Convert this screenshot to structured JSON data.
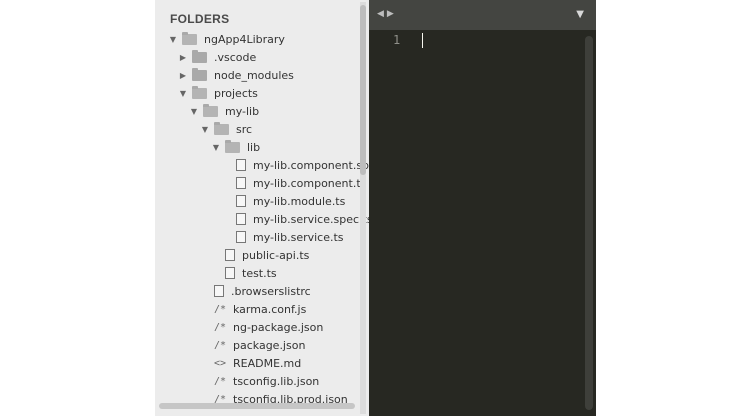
{
  "sidebar": {
    "title": "FOLDERS",
    "items": [
      {
        "label": "ngApp4Library",
        "type": "folder",
        "state": "open"
      },
      {
        "label": ".vscode",
        "type": "folder",
        "state": "closed"
      },
      {
        "label": "node_modules",
        "type": "folder",
        "state": "closed"
      },
      {
        "label": "projects",
        "type": "folder",
        "state": "open"
      },
      {
        "label": "my-lib",
        "type": "folder",
        "state": "open"
      },
      {
        "label": "src",
        "type": "folder",
        "state": "open"
      },
      {
        "label": "lib",
        "type": "folder",
        "state": "open"
      },
      {
        "label": "my-lib.component.sp",
        "type": "file",
        "icon": "file-icon"
      },
      {
        "label": "my-lib.component.ts",
        "type": "file",
        "icon": "file-icon"
      },
      {
        "label": "my-lib.module.ts",
        "type": "file",
        "icon": "file-icon"
      },
      {
        "label": "my-lib.service.spec.ts",
        "type": "file",
        "icon": "file-icon"
      },
      {
        "label": "my-lib.service.ts",
        "type": "file",
        "icon": "file-icon"
      },
      {
        "label": "public-api.ts",
        "type": "file",
        "icon": "file-icon"
      },
      {
        "label": "test.ts",
        "type": "file",
        "icon": "file-icon"
      },
      {
        "label": ".browserslistrc",
        "type": "file",
        "icon": "file-icon"
      },
      {
        "label": "karma.conf.js",
        "type": "file",
        "icon": "js-comment-icon",
        "glyph": "/*"
      },
      {
        "label": "ng-package.json",
        "type": "file",
        "icon": "json-comment-icon",
        "glyph": "/*"
      },
      {
        "label": "package.json",
        "type": "file",
        "icon": "json-comment-icon",
        "glyph": "/*"
      },
      {
        "label": "README.md",
        "type": "file",
        "icon": "markup-icon",
        "glyph": "<>"
      },
      {
        "label": "tsconfig.lib.json",
        "type": "file",
        "icon": "json-comment-icon",
        "glyph": "/*"
      },
      {
        "label": "tsconfig.lib.prod.json",
        "type": "file",
        "icon": "json-comment-icon",
        "glyph": "/*"
      }
    ]
  },
  "editor": {
    "line_number": "1",
    "nav_left": "◀",
    "nav_right": "▶",
    "dropdown": "▼"
  },
  "colors": {
    "sidebar_bg": "#ececec",
    "editor_bg": "#272822",
    "tabbar_bg": "#444541",
    "gutter_text": "#8f908a"
  }
}
